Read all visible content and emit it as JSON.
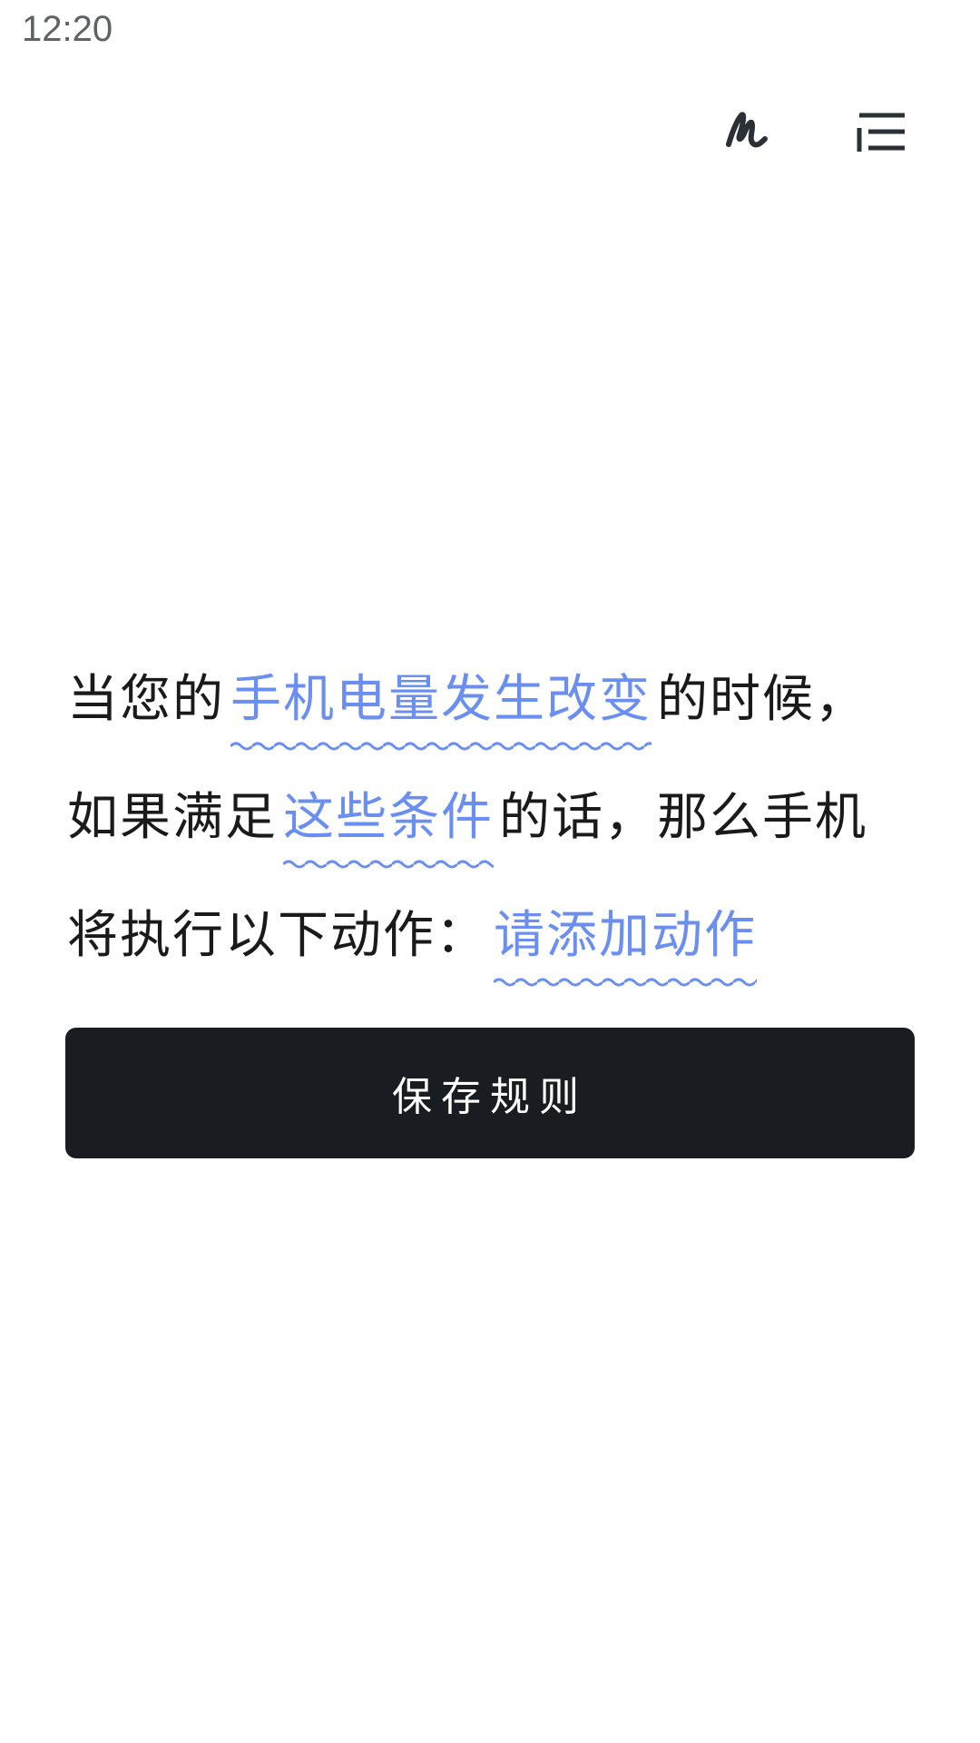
{
  "status_bar": {
    "time": "12:20"
  },
  "toolbar": {
    "icons": [
      "signature-icon",
      "list-menu-icon"
    ]
  },
  "rule": {
    "line1": {
      "prefix": "当您的",
      "trigger_link": "手机电量发生改变",
      "suffix": "的时候，"
    },
    "line2": {
      "prefix": "如果满足",
      "condition_link": "这些条件",
      "suffix": "的话，那么手机"
    },
    "line3": {
      "prefix": "将执行以下动作：",
      "action_link": "请添加动作"
    }
  },
  "save_button": {
    "label": "保存规则"
  },
  "colors": {
    "link": "#6b8ff0",
    "button_bg": "#191c20",
    "text": "#1a1a1a",
    "status_text": "#5f6368"
  }
}
